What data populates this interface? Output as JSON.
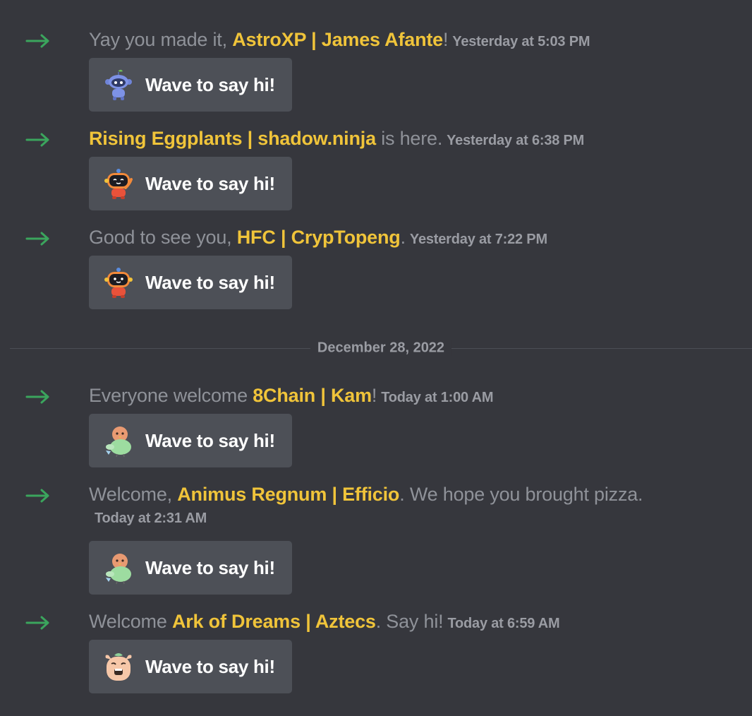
{
  "messages": [
    {
      "prefix": "Yay you made it, ",
      "name": "AstroXP | James Afante",
      "suffix": "!",
      "timestamp": "Yesterday at 5:03 PM",
      "wave_label": "Wave to say hi!",
      "sticker_icon": "blue-robot-wumpus-sticker"
    },
    {
      "prefix": "",
      "name": "Rising Eggplants | shadow.ninja",
      "suffix": " is here.",
      "timestamp": "Yesterday at 6:38 PM",
      "wave_label": "Wave to say hi!",
      "sticker_icon": "orange-robot-waving-sticker"
    },
    {
      "prefix": "Good to see you, ",
      "name": "HFC | CrypTopeng",
      "suffix": ".",
      "timestamp": "Yesterday at 7:22 PM",
      "wave_label": "Wave to say hi!",
      "sticker_icon": "orange-robot-sticker"
    },
    {
      "prefix": "Everyone welcome ",
      "name": "8Chain | Kam",
      "suffix": "!",
      "timestamp": "Today at 1:00 AM",
      "wave_label": "Wave to say hi!",
      "sticker_icon": "green-bird-sticker"
    },
    {
      "prefix": "Welcome, ",
      "name": "Animus Regnum | Efficio",
      "suffix": ". We hope you brought pizza.",
      "timestamp": "Today at 2:31 AM",
      "wave_label": "Wave to say hi!",
      "sticker_icon": "green-bird-sticker"
    },
    {
      "prefix": "Welcome ",
      "name": "Ark of Dreams | Aztecs",
      "suffix": ". Say hi!",
      "timestamp": "Today at 6:59 AM",
      "wave_label": "Wave to say hi!",
      "sticker_icon": "peach-creature-sticker"
    }
  ],
  "date_divider": "December 28, 2022",
  "colors": {
    "background": "#36373d",
    "username": "#f0c43a",
    "message_text": "#8f9299",
    "timestamp": "#9a9ca3",
    "join_arrow": "#3ba55d",
    "wave_button": "#4d5057"
  }
}
